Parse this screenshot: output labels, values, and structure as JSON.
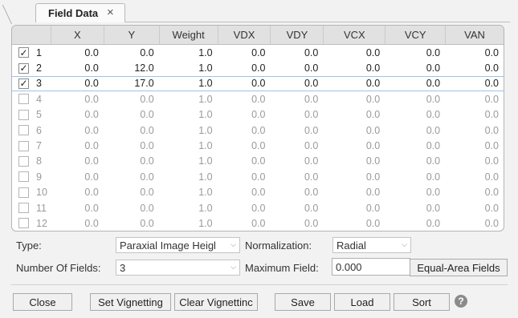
{
  "tab": {
    "title": "Field Data",
    "close_glyph": "×"
  },
  "grid": {
    "columns": [
      "",
      "X",
      "Y",
      "Weight",
      "VDX",
      "VDY",
      "VCX",
      "VCY",
      "VAN"
    ],
    "rows": [
      {
        "n": "1",
        "checked": true,
        "enabled": true,
        "vals": [
          "0.0",
          "0.0",
          "1.0",
          "0.0",
          "0.0",
          "0.0",
          "0.0",
          "0.0"
        ]
      },
      {
        "n": "2",
        "checked": true,
        "enabled": true,
        "vals": [
          "0.0",
          "12.0",
          "1.0",
          "0.0",
          "0.0",
          "0.0",
          "0.0",
          "0.0"
        ]
      },
      {
        "n": "3",
        "checked": true,
        "enabled": true,
        "vals": [
          "0.0",
          "17.0",
          "1.0",
          "0.0",
          "0.0",
          "0.0",
          "0.0",
          "0.0"
        ]
      },
      {
        "n": "4",
        "checked": false,
        "enabled": false,
        "vals": [
          "0.0",
          "0.0",
          "1.0",
          "0.0",
          "0.0",
          "0.0",
          "0.0",
          "0.0"
        ]
      },
      {
        "n": "5",
        "checked": false,
        "enabled": false,
        "vals": [
          "0.0",
          "0.0",
          "1.0",
          "0.0",
          "0.0",
          "0.0",
          "0.0",
          "0.0"
        ]
      },
      {
        "n": "6",
        "checked": false,
        "enabled": false,
        "vals": [
          "0.0",
          "0.0",
          "1.0",
          "0.0",
          "0.0",
          "0.0",
          "0.0",
          "0.0"
        ]
      },
      {
        "n": "7",
        "checked": false,
        "enabled": false,
        "vals": [
          "0.0",
          "0.0",
          "1.0",
          "0.0",
          "0.0",
          "0.0",
          "0.0",
          "0.0"
        ]
      },
      {
        "n": "8",
        "checked": false,
        "enabled": false,
        "vals": [
          "0.0",
          "0.0",
          "1.0",
          "0.0",
          "0.0",
          "0.0",
          "0.0",
          "0.0"
        ]
      },
      {
        "n": "9",
        "checked": false,
        "enabled": false,
        "vals": [
          "0.0",
          "0.0",
          "1.0",
          "0.0",
          "0.0",
          "0.0",
          "0.0",
          "0.0"
        ]
      },
      {
        "n": "10",
        "checked": false,
        "enabled": false,
        "vals": [
          "0.0",
          "0.0",
          "1.0",
          "0.0",
          "0.0",
          "0.0",
          "0.0",
          "0.0"
        ]
      },
      {
        "n": "11",
        "checked": false,
        "enabled": false,
        "vals": [
          "0.0",
          "0.0",
          "1.0",
          "0.0",
          "0.0",
          "0.0",
          "0.0",
          "0.0"
        ]
      },
      {
        "n": "12",
        "checked": false,
        "enabled": false,
        "vals": [
          "0.0",
          "0.0",
          "1.0",
          "0.0",
          "0.0",
          "0.0",
          "0.0",
          "0.0"
        ]
      }
    ]
  },
  "controls": {
    "type_label": "Type:",
    "type_value": "Paraxial Image Heigl",
    "normalization_label": "Normalization:",
    "normalization_value": "Radial",
    "num_fields_label": "Number Of Fields:",
    "num_fields_value": "3",
    "max_field_label": "Maximum Field:",
    "max_field_value": "0.000",
    "equal_area_label": "Equal-Area Fields"
  },
  "buttons": {
    "close": "Close",
    "set_vignetting": "Set Vignetting",
    "clear_vignetting": "Clear Vignettinc",
    "save": "Save",
    "load": "Load",
    "sort": "Sort",
    "help_glyph": "?"
  },
  "colors": {
    "row_selected_border": "#9cc3ea",
    "header_bg": "#e1e1e1",
    "disabled_text": "#9a9a9a"
  },
  "icons": {
    "checkmark": "✓",
    "caret": "⌵"
  }
}
